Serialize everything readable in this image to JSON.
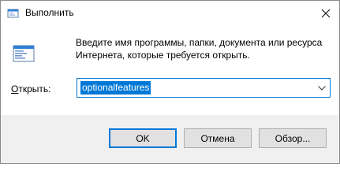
{
  "window": {
    "title": "Выполнить",
    "icon": "run-icon",
    "close_icon": "close-icon"
  },
  "dialog": {
    "description": "Введите имя программы, папки, документа или ресурса Интернета, которые требуется открыть.",
    "open_label_accel": "О",
    "open_label_rest": "ткрыть:",
    "open_value": "optionalfeatures"
  },
  "buttons": {
    "ok": "OK",
    "cancel": "Отмена",
    "browse": "Обзор..."
  },
  "colors": {
    "accent": "#0078d7",
    "footer_bg": "#f0f0f0",
    "button_bg": "#e1e1e1"
  }
}
